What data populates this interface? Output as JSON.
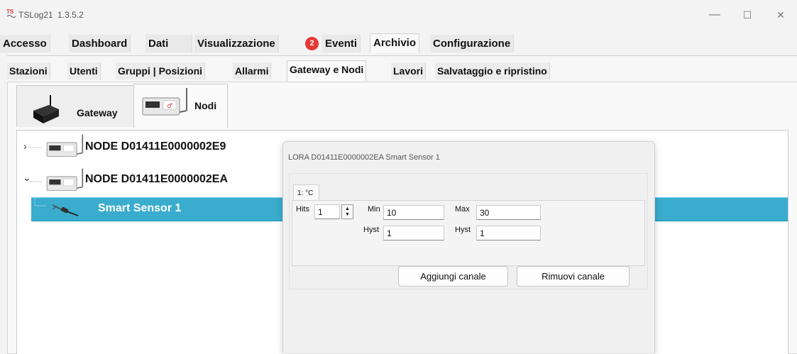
{
  "window": {
    "icon_text": "TS",
    "title": "TSLog21",
    "version": "1.3.5.2",
    "controls": {
      "minimize": "—",
      "maximize": "☐",
      "close": "✕"
    }
  },
  "menu": {
    "items": [
      "Accesso",
      "Dashboard",
      "Dati",
      "Visualizzazione",
      "Eventi",
      "Archivio",
      "Configurazione"
    ],
    "events_badge": "2",
    "active": "Archivio"
  },
  "subtabs": {
    "items": [
      "Stazioni",
      "Utenti",
      "Gruppi | Posizioni",
      "Allarmi",
      "Gateway e Nodi",
      "Lavori",
      "Salvataggio e ripristino"
    ],
    "active": "Gateway e Nodi"
  },
  "device_tabs": {
    "gateway_label": "Gateway",
    "nodes_label": "Nodi",
    "active": "Nodi"
  },
  "tree": {
    "node1": {
      "expander": "›",
      "label": "NODE D01411E0000002E9"
    },
    "node2": {
      "expander": "⌄",
      "label": "NODE D01411E0000002EA"
    },
    "sensor": {
      "label": "Smart Sensor 1",
      "selected": true
    }
  },
  "dialog": {
    "title": "LORA D01411E0000002EA Smart Sensor 1",
    "channel_tab": "1: °C",
    "hits_label": "Hits",
    "hits_value": "1",
    "min_label": "Min",
    "min_value": "10",
    "max_label": "Max",
    "max_value": "30",
    "hyst_label": "Hyst",
    "hyst_min_value": "1",
    "hyst_max_value": "1",
    "add_button": "Aggiungi canale",
    "remove_button": "Rimuovi canale"
  },
  "colors": {
    "selection": "#3aaccd",
    "badge": "#e53935",
    "window_bg": "#f3f3f3"
  }
}
